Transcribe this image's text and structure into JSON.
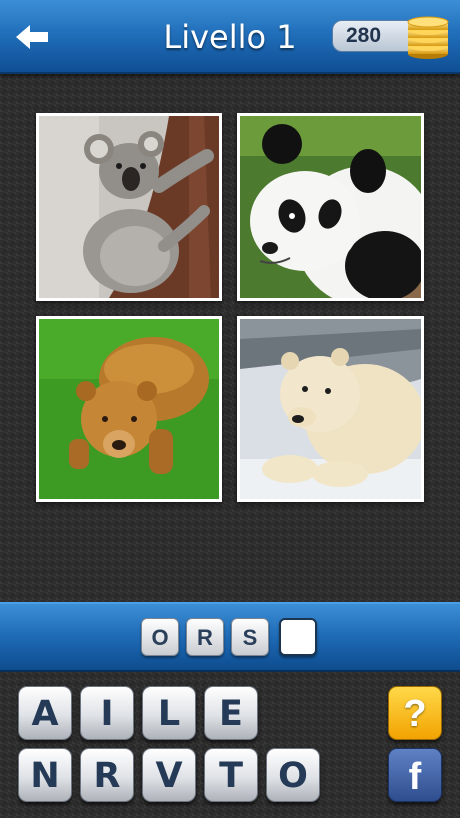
{
  "header": {
    "title": "Livello 1",
    "coins": "280",
    "back_icon": "back-arrow-icon",
    "coin_icon": "coin-stack-icon",
    "color": "#1f6cb8"
  },
  "puzzle": {
    "images": [
      "koala",
      "giant panda",
      "brown bear",
      "polar bear"
    ]
  },
  "answer": {
    "letters": [
      "O",
      "R",
      "S",
      ""
    ]
  },
  "keyboard": {
    "row1": [
      "A",
      "I",
      "L",
      "E"
    ],
    "row2": [
      "N",
      "R",
      "V",
      "T",
      "O"
    ],
    "hint_label": "?",
    "facebook_label": "f"
  }
}
